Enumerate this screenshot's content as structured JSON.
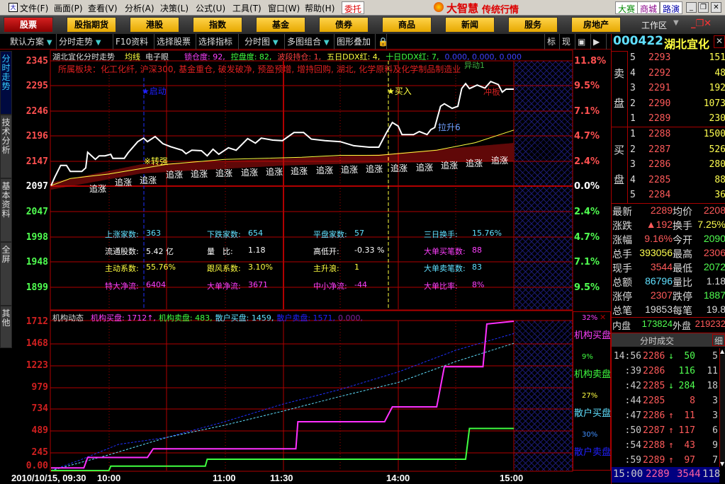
{
  "menubar": {
    "items": [
      "文件(F)",
      "画面(P)",
      "查看(V)",
      "分析(A)",
      "决策(L)",
      "公式(U)",
      "工具(T)",
      "窗口(W)",
      "帮助(H)"
    ],
    "trade": "委托",
    "brand": "大智慧",
    "brand_sub": "传统行情",
    "links": [
      "大赛",
      "商城",
      "路演"
    ]
  },
  "categories": [
    "股票",
    "股指期货",
    "港股",
    "指数",
    "基金",
    "债券",
    "商品",
    "新闻",
    "服务",
    "房地产"
  ],
  "workspace": "工作区",
  "toolbar": {
    "items": [
      "默认方案",
      "分时走势",
      "F10资料",
      "选择股票",
      "选择指标",
      "分时图",
      "多图组合",
      "图形叠加"
    ],
    "right": [
      "标",
      "现"
    ]
  },
  "stock": {
    "code": "000422",
    "name": "湖北宜化"
  },
  "left_tabs": [
    "分时走势",
    "技术分析",
    "基本资料",
    "全屏",
    "其他"
  ],
  "main": {
    "title": "湖北宜化分时走势",
    "avg_label": "均线",
    "eye_label": "电子眼",
    "metrics": [
      {
        "t": "锁仓度: 92,",
        "c": "#ff40ff"
      },
      {
        "t": "控盘度: 82,",
        "c": "#40ff40"
      },
      {
        "t": "波段持仓: 1,",
        "c": "#ff4040"
      },
      {
        "t": "五日DDX红: 4,",
        "c": "#ffff40"
      },
      {
        "t": "十日DDX红: 7,",
        "c": "#40ff40"
      },
      {
        "t": "0.000, 0.000, 0.000",
        "c": "#4040ff"
      }
    ],
    "sector": "所属板块：化工化纤, 沪深300, 基金重仓, 破发破净, 预盈预增, 增持回购, 湖北, 化学原料及化学制品制造业",
    "price_axis": [
      "2345",
      "2295",
      "2246",
      "2196",
      "2147",
      "2097",
      "2047",
      "1998",
      "1948",
      "1899"
    ],
    "pct_axis": [
      "11.8%",
      "9.5%",
      "7.1%",
      "4.7%",
      "2.4%",
      "0.0%",
      "2.4%",
      "4.7%",
      "7.1%",
      "9.5%"
    ],
    "annotations": {
      "start": "★启动",
      "buy": "★买入",
      "strong": "※转强",
      "surge": "异动1",
      "pull": "拉升6",
      "hit": "冲板",
      "chase": "追涨"
    },
    "stats": [
      [
        {
          "l": "上涨家数:",
          "v": "363",
          "c": "#60e0ff"
        },
        {
          "l": "下跌家数:",
          "v": "654",
          "c": "#60e0ff"
        },
        {
          "l": "平盘家数:",
          "v": "57",
          "c": "#60e0ff"
        },
        {
          "l": "三日换手:",
          "v": "15.76%",
          "c": "#60e0ff"
        }
      ],
      [
        {
          "l": "流通股数:",
          "v": "5.42 亿",
          "c": "#ffffff"
        },
        {
          "l": "量　比:",
          "v": "1.18",
          "c": "#ffffff"
        },
        {
          "l": "高低开:",
          "v": "-0.33 %",
          "c": "#ffffff"
        },
        {
          "l": "大单买笔数:",
          "v": "88",
          "c": "#ff40ff"
        }
      ],
      [
        {
          "l": "主动系数:",
          "v": "55.76%",
          "c": "#ffff40"
        },
        {
          "l": "跟风系数:",
          "v": "3.10%",
          "c": "#ffff40"
        },
        {
          "l": "主升浪:",
          "v": "1",
          "c": "#ffff40"
        },
        {
          "l": "大单卖笔数:",
          "v": "83",
          "c": "#60e0ff"
        }
      ],
      [
        {
          "l": "特大净流:",
          "v": "6404",
          "c": "#ff40ff"
        },
        {
          "l": "大单净流:",
          "v": "3671",
          "c": "#ff40ff"
        },
        {
          "l": "中小净流:",
          "v": "-44",
          "c": "#ff40ff"
        },
        {
          "l": "大单比率:",
          "v": "8%",
          "c": "#ff40ff"
        }
      ]
    ]
  },
  "lower": {
    "title": "机构动态",
    "legend": [
      {
        "t": "机构买盘: 1712↑,",
        "c": "#ff40ff"
      },
      {
        "t": "机构卖盘: 483,",
        "c": "#40ff40"
      },
      {
        "t": "散户买盘: 1459,",
        "c": "#60e0ff"
      },
      {
        "t": "散户卖盘: 1571,",
        "c": "#2020ff"
      },
      {
        "t": "0.000,",
        "c": "#8020a0"
      }
    ],
    "y_axis": [
      "1712",
      "1468",
      "1223",
      "979",
      "734",
      "489",
      "245",
      "0.00"
    ],
    "side": [
      {
        "pct": "32%",
        "pc": "#ff40ff",
        "name": "机构买盘",
        "nc": "#ff40ff"
      },
      {
        "pct": "9%",
        "pc": "#40ff40",
        "name": "机构卖盘",
        "nc": "#40ff40"
      },
      {
        "pct": "27%",
        "pc": "#ffff40",
        "name": "散户买盘",
        "nc": "#60e0ff"
      },
      {
        "pct": "30%",
        "pc": "#4090ff",
        "name": "散户卖盘",
        "nc": "#2020ff"
      }
    ],
    "time_axis": [
      "2010/10/15, 09:30",
      "10:00",
      "11:00",
      "11:30",
      "14:00",
      "15:00"
    ]
  },
  "chart_data": {
    "type": "line",
    "price": [
      [
        0,
        2098
      ],
      [
        2,
        2115
      ],
      [
        5,
        2138
      ],
      [
        8,
        2138
      ],
      [
        10,
        2126
      ],
      [
        16,
        2126
      ],
      [
        18,
        2133
      ],
      [
        19,
        2164
      ],
      [
        23,
        2150
      ],
      [
        25,
        2157
      ],
      [
        28,
        2157
      ],
      [
        31,
        2160
      ],
      [
        32,
        2152
      ],
      [
        38,
        2152
      ],
      [
        40,
        2163
      ],
      [
        45,
        2185
      ],
      [
        48,
        2192
      ],
      [
        50,
        2185
      ],
      [
        54,
        2195
      ],
      [
        58,
        2181
      ],
      [
        62,
        2175
      ],
      [
        68,
        2168
      ],
      [
        70,
        2161
      ],
      [
        73,
        2168
      ],
      [
        78,
        2167
      ],
      [
        81,
        2157
      ],
      [
        84,
        2170
      ],
      [
        87,
        2160
      ],
      [
        92,
        2173
      ],
      [
        96,
        2168
      ],
      [
        102,
        2191
      ],
      [
        106,
        2182
      ],
      [
        109,
        2192
      ],
      [
        115,
        2188
      ],
      [
        120,
        2187
      ],
      [
        126,
        2203
      ],
      [
        131,
        2203
      ],
      [
        135,
        2190
      ],
      [
        142,
        2187
      ],
      [
        150,
        2185
      ],
      [
        157,
        2177
      ],
      [
        165,
        2174
      ],
      [
        170,
        2174
      ],
      [
        174,
        2203
      ],
      [
        177,
        2223
      ],
      [
        180,
        2216
      ],
      [
        182,
        2199
      ],
      [
        188,
        2199
      ],
      [
        191,
        2205
      ],
      [
        195,
        2199
      ],
      [
        197,
        2209
      ],
      [
        199,
        2213
      ],
      [
        202,
        2255
      ],
      [
        204,
        2260
      ],
      [
        208,
        2251
      ],
      [
        211,
        2255
      ],
      [
        213,
        2290
      ],
      [
        215,
        2300
      ],
      [
        217,
        2290
      ],
      [
        221,
        2297
      ],
      [
        225,
        2291
      ],
      [
        228,
        2304
      ],
      [
        232,
        2298
      ],
      [
        234,
        2283
      ],
      [
        236,
        2289
      ],
      [
        240,
        2289
      ]
    ],
    "avg": [
      [
        0,
        2098
      ],
      [
        10,
        2112
      ],
      [
        30,
        2121
      ],
      [
        60,
        2140
      ],
      [
        90,
        2150
      ],
      [
        130,
        2154
      ],
      [
        150,
        2158
      ],
      [
        170,
        2158
      ],
      [
        200,
        2168
      ],
      [
        220,
        2183
      ],
      [
        240,
        2208
      ]
    ],
    "inst_buy": [
      [
        0,
        30
      ],
      [
        17,
        30
      ],
      [
        19,
        150
      ],
      [
        50,
        150
      ],
      [
        53,
        250
      ],
      [
        127,
        250
      ],
      [
        128,
        560
      ],
      [
        173,
        560
      ],
      [
        177,
        730
      ],
      [
        200,
        730
      ],
      [
        204,
        1190
      ],
      [
        224,
        1190
      ],
      [
        226,
        1680
      ],
      [
        240,
        1712
      ]
    ],
    "inst_sell": [
      [
        0,
        0
      ],
      [
        30,
        0
      ],
      [
        31,
        50
      ],
      [
        80,
        50
      ],
      [
        81,
        130
      ],
      [
        215,
        130
      ],
      [
        217,
        483
      ],
      [
        240,
        483
      ]
    ],
    "retail_buy": [
      [
        0,
        0
      ],
      [
        10,
        60
      ],
      [
        30,
        180
      ],
      [
        60,
        380
      ],
      [
        90,
        520
      ],
      [
        120,
        680
      ],
      [
        150,
        850
      ],
      [
        180,
        1010
      ],
      [
        210,
        1250
      ],
      [
        240,
        1459
      ]
    ],
    "retail_sell": [
      [
        0,
        0
      ],
      [
        15,
        120
      ],
      [
        35,
        300
      ],
      [
        60,
        380
      ],
      [
        90,
        560
      ],
      [
        120,
        760
      ],
      [
        150,
        930
      ],
      [
        180,
        1130
      ],
      [
        210,
        1380
      ],
      [
        240,
        1571
      ]
    ]
  },
  "orderbook": {
    "sell_label": [
      "卖",
      "盘"
    ],
    "buy_label": [
      "买",
      "盘"
    ],
    "sell": [
      [
        "5",
        "2293",
        "151"
      ],
      [
        "4",
        "2292",
        "48"
      ],
      [
        "3",
        "2291",
        "192"
      ],
      [
        "2",
        "2290",
        "1073"
      ],
      [
        "1",
        "2289",
        "230"
      ]
    ],
    "buy": [
      [
        "1",
        "2288",
        "1500"
      ],
      [
        "2",
        "2287",
        "526"
      ],
      [
        "3",
        "2286",
        "280"
      ],
      [
        "4",
        "2285",
        "88"
      ],
      [
        "5",
        "2284",
        "36"
      ]
    ]
  },
  "quote": [
    [
      {
        "t": "最新",
        "c": "wht"
      },
      {
        "t": "2289",
        "c": "red"
      },
      {
        "t": "均价",
        "c": "wht"
      },
      {
        "t": "2208",
        "c": "red"
      }
    ],
    [
      {
        "t": "涨跌",
        "c": "wht"
      },
      {
        "t": "▲192",
        "c": "red"
      },
      {
        "t": "换手",
        "c": "wht"
      },
      {
        "t": "7.25%",
        "c": "yel"
      }
    ],
    [
      {
        "t": "涨幅",
        "c": "wht"
      },
      {
        "t": "9.16%",
        "c": "red"
      },
      {
        "t": "今开",
        "c": "wht"
      },
      {
        "t": "2090",
        "c": "grn"
      }
    ],
    [
      {
        "t": "总手",
        "c": "wht"
      },
      {
        "t": "393056",
        "c": "yel"
      },
      {
        "t": "最高",
        "c": "wht"
      },
      {
        "t": "2306",
        "c": "red"
      }
    ],
    [
      {
        "t": "现手",
        "c": "wht"
      },
      {
        "t": "3544",
        "c": "red"
      },
      {
        "t": "最低",
        "c": "wht"
      },
      {
        "t": "2072",
        "c": "grn"
      }
    ],
    [
      {
        "t": "总额",
        "c": "wht"
      },
      {
        "t": "86796",
        "c": "cyn"
      },
      {
        "t": "量比",
        "c": "wht"
      },
      {
        "t": "1.18",
        "c": "wht"
      }
    ],
    [
      {
        "t": "涨停",
        "c": "wht"
      },
      {
        "t": "2307",
        "c": "red"
      },
      {
        "t": "跌停",
        "c": "wht"
      },
      {
        "t": "1887",
        "c": "grn"
      }
    ],
    [
      {
        "t": "总笔",
        "c": "wht"
      },
      {
        "t": "19853",
        "c": "wht"
      },
      {
        "t": "每笔",
        "c": "wht"
      },
      {
        "t": "19.8",
        "c": "wht"
      }
    ],
    [
      {
        "t": "内盘",
        "c": "wht"
      },
      {
        "t": "173824",
        "c": "grn"
      },
      {
        "t": "外盘",
        "c": "wht"
      },
      {
        "t": "219232",
        "c": "red"
      }
    ]
  ],
  "trades": {
    "title": "分时成交",
    "detail": "细",
    "rows": [
      [
        "14:56",
        "2286",
        "↓",
        "50",
        "5"
      ],
      [
        ":39",
        "2286",
        "",
        "116",
        "11"
      ],
      [
        ":42",
        "2285",
        "↓",
        "284",
        "18"
      ],
      [
        ":44",
        "2285",
        "",
        "8",
        "3"
      ],
      [
        ":47",
        "2286",
        "↑",
        "11",
        "3"
      ],
      [
        ":50",
        "2287",
        "↑",
        "117",
        "6"
      ],
      [
        ":54",
        "2288",
        "↑",
        "43",
        "9"
      ],
      [
        ":59",
        "2289",
        "↑",
        "97",
        "7"
      ]
    ],
    "last": [
      "15:00",
      "2289",
      "3544",
      "118"
    ]
  }
}
